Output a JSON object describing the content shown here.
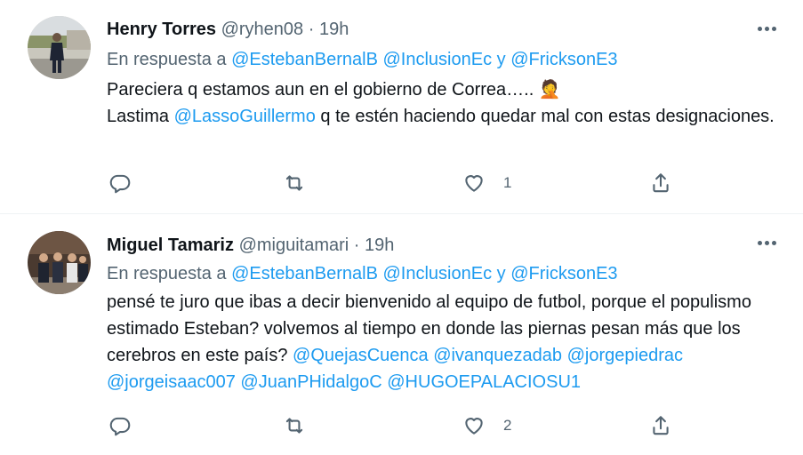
{
  "tweets": [
    {
      "name": "Henry Torres",
      "handle": "@ryhen08",
      "separator": "·",
      "time": "19h",
      "reply_prefix": "En respuesta a",
      "reply_mentions": [
        "@EstebanBernalB",
        "@InclusionEc"
      ],
      "reply_and": "y",
      "reply_last": "@FricksonE3",
      "text_line1": "Pareciera q estamos aun en el gobierno de Correa….. ",
      "emoji": "🤦",
      "text_line2_before": "Lastima ",
      "text_line2_mention": "@LassoGuillermo",
      "text_line2_after": " q te estén haciendo quedar mal con estas designaciones.",
      "like_count": "1",
      "icons": {
        "reply": "reply-icon",
        "retweet": "retweet-icon",
        "like": "heart-icon",
        "share": "share-icon",
        "more": "more-icon"
      }
    },
    {
      "name": "Miguel Tamariz",
      "handle": "@miguitamari",
      "separator": "·",
      "time": "19h",
      "reply_prefix": "En respuesta a",
      "reply_mentions": [
        "@EstebanBernalB",
        "@InclusionEc"
      ],
      "reply_and": "y",
      "reply_last": "@FricksonE3",
      "text": "pensé te juro que ibas a decir bienvenido al equipo de futbol, porque el populismo estimado Esteban? volvemos al tiempo en donde las piernas pesan más que los cerebros en este país? ",
      "text_mentions": [
        "@QuejasCuenca",
        "@ivanquezadab",
        "@jorgepiedrac",
        "@jorgeisaac007",
        "@JuanPHidalgoC",
        "@HUGOEPALACIOSU1"
      ],
      "like_count": "2",
      "icons": {
        "reply": "reply-icon",
        "retweet": "retweet-icon",
        "like": "heart-icon",
        "share": "share-icon",
        "more": "more-icon"
      }
    }
  ],
  "colors": {
    "link": "#1d9bf0",
    "secondary": "#536471",
    "text": "#0f1419",
    "divider": "#eff3f4"
  }
}
